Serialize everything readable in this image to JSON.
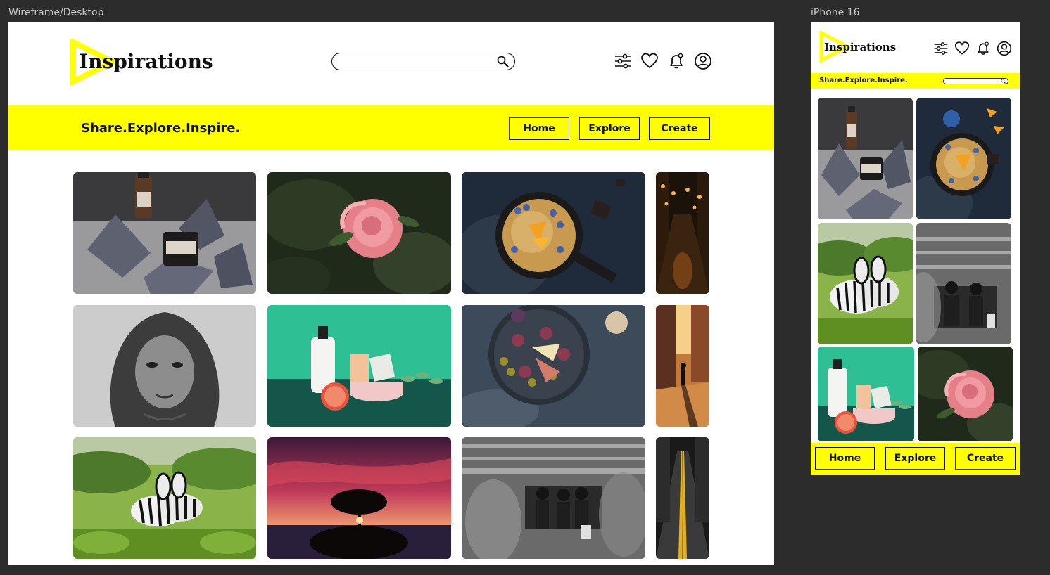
{
  "frames": {
    "desktop_label": "Wireframe/Desktop",
    "mobile_label": "iPhone 16"
  },
  "brand": {
    "name": "Inspirations",
    "tagline": "Share.Explore.Inspire.",
    "accent_color": "#ffff00"
  },
  "search": {
    "placeholder": ""
  },
  "header_icons": [
    "filter-sliders-icon",
    "heart-icon",
    "bell-icon",
    "user-profile-icon"
  ],
  "nav": {
    "home": "Home",
    "explore": "Explore",
    "create": "Create"
  },
  "desktop_gallery": [
    "skincare-products-on-rocks",
    "pink-rose",
    "pancake-skillet-with-blueberries",
    "night-street-lanterns",
    "bw-portrait-hooded-woman",
    "lotion-bottle-grapefruit-green",
    "figs-cheese-platter",
    "silhouette-walker-sunset-street",
    "zebras-in-grass",
    "tree-silhouette-red-sunset",
    "bw-motion-blur-crowd",
    "night-road-yellow-lines"
  ],
  "mobile_gallery": [
    "skincare-products-on-rocks",
    "pancake-skillet-with-blueberries",
    "zebras-in-grass",
    "bw-motion-blur-crowd",
    "lotion-bottle-grapefruit-green",
    "pink-rose"
  ]
}
